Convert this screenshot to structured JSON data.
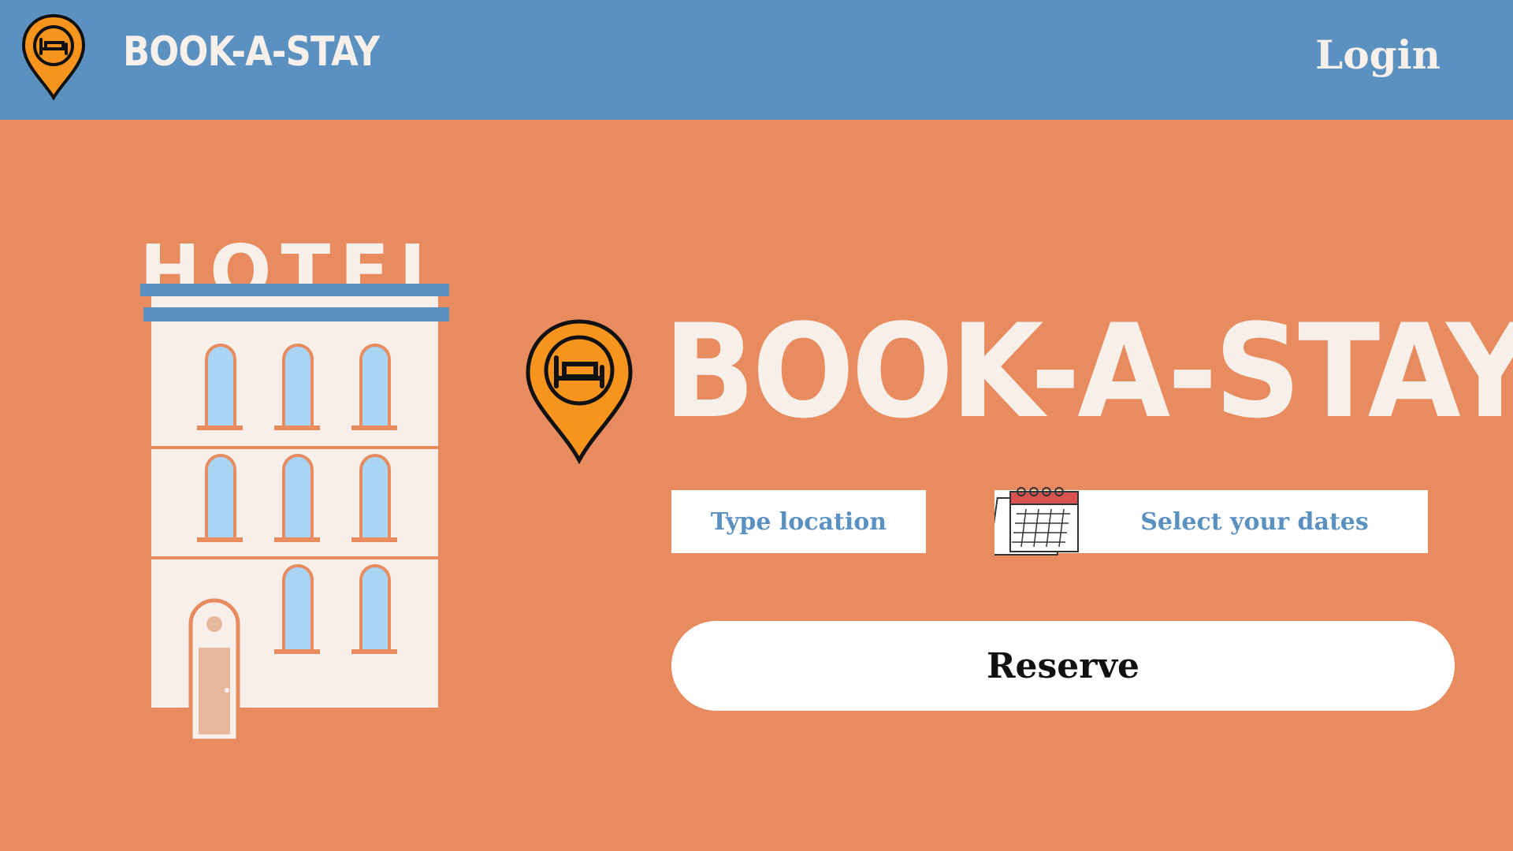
{
  "header": {
    "brand": "BOOK-A-STAY",
    "login_label": "Login"
  },
  "hotel_sign": "HOTEL",
  "hero": {
    "title": "BOOK-A-STAY"
  },
  "search": {
    "location_placeholder": "Type location",
    "dates_placeholder": "Select your dates",
    "reserve_label": "Reserve"
  },
  "colors": {
    "background": "#E88B5F",
    "header": "#5B91C1",
    "pin": "#F7941D",
    "text_light": "#F6EFEA",
    "field_text": "#5B91C1"
  },
  "icons": [
    "map-pin-bed-icon",
    "calendar-icon",
    "hotel-building-illustration"
  ]
}
